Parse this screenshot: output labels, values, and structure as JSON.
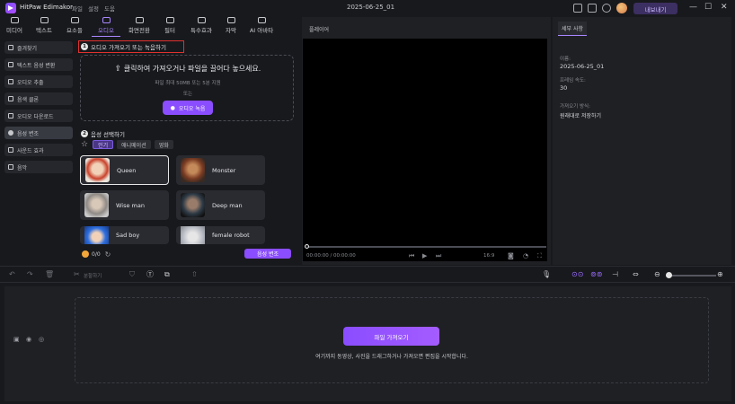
{
  "titlebar": {
    "app_name": "HitPaw Edimakor",
    "menus": [
      "파일",
      "설정",
      "도움"
    ],
    "project_title": "2025-06-25_01",
    "export_label": "내보내기",
    "window_controls": [
      "—",
      "☐",
      "✕"
    ]
  },
  "tabs": [
    {
      "label": "미디어",
      "icon": "media-icon"
    },
    {
      "label": "텍스트",
      "icon": "text-icon"
    },
    {
      "label": "요소들",
      "icon": "elements-icon"
    },
    {
      "label": "오디오",
      "icon": "audio-icon",
      "active": true
    },
    {
      "label": "화면전환",
      "icon": "transition-icon"
    },
    {
      "label": "필터",
      "icon": "filter-icon"
    },
    {
      "label": "특수효과",
      "icon": "effects-icon"
    },
    {
      "label": "자막",
      "icon": "subtitle-icon"
    },
    {
      "label": "AI 아바타",
      "icon": "ai-avatar-icon"
    }
  ],
  "sidebar": {
    "items": [
      {
        "label": "즐겨찾기",
        "icon": "star-icon"
      },
      {
        "label": "텍스트 음성 변환",
        "icon": "tts-icon"
      },
      {
        "label": "오디오 추출",
        "icon": "mic-icon"
      },
      {
        "label": "음색 클론",
        "icon": "clone-icon"
      },
      {
        "label": "오디오 다운로드",
        "icon": "download-icon"
      },
      {
        "label": "음성 변조",
        "icon": "voice-changer-icon",
        "active": true
      },
      {
        "label": "사운드 효과",
        "icon": "sound-effect-icon"
      },
      {
        "label": "음악",
        "icon": "music-icon"
      }
    ]
  },
  "step1": {
    "number": "1",
    "title": "오디오 가져오기 또는 녹음하기",
    "drop_text": "클릭하여 가져오거나 파일을 끌어다 놓으세요.",
    "limit_text": "파일 최대 50MB 또는 5분 지원",
    "or_text": "또는",
    "record_label": "오디오 녹음"
  },
  "step2": {
    "number": "2",
    "title": "음성 선택하기",
    "filter_tabs": [
      "인기",
      "애니메이션",
      "영화"
    ],
    "voices": [
      {
        "name": "Queen",
        "selected": true
      },
      {
        "name": "Monster"
      },
      {
        "name": "Wise man"
      },
      {
        "name": "Deep man"
      },
      {
        "name": "Sad boy"
      },
      {
        "name": "female robot"
      }
    ],
    "credits": "0/0",
    "change_label": "음성 변조"
  },
  "player": {
    "header": "플레이어",
    "time": "00:00:00 / 00:00:00",
    "ratio": "16:9"
  },
  "properties": {
    "tab": "세부 사항",
    "name_label": "이름:",
    "name_value": "2025-06-25_01",
    "fps_label": "프레임 속도:",
    "fps_value": "30",
    "import_label": "가져오기 방식:",
    "import_value": "원래대로 저장하기"
  },
  "timeline": {
    "toolbar": {
      "split_label": "분할하기"
    },
    "import_button": "파일 가져오기",
    "hint": "여기까지 동영상, 사진을 드래그하거나 가져오면 편집을 시작합니다."
  },
  "colors": {
    "accent": "#8a4dff",
    "highlight_box": "#e0312f",
    "background": "#18191d",
    "panel": "#1f2024"
  }
}
